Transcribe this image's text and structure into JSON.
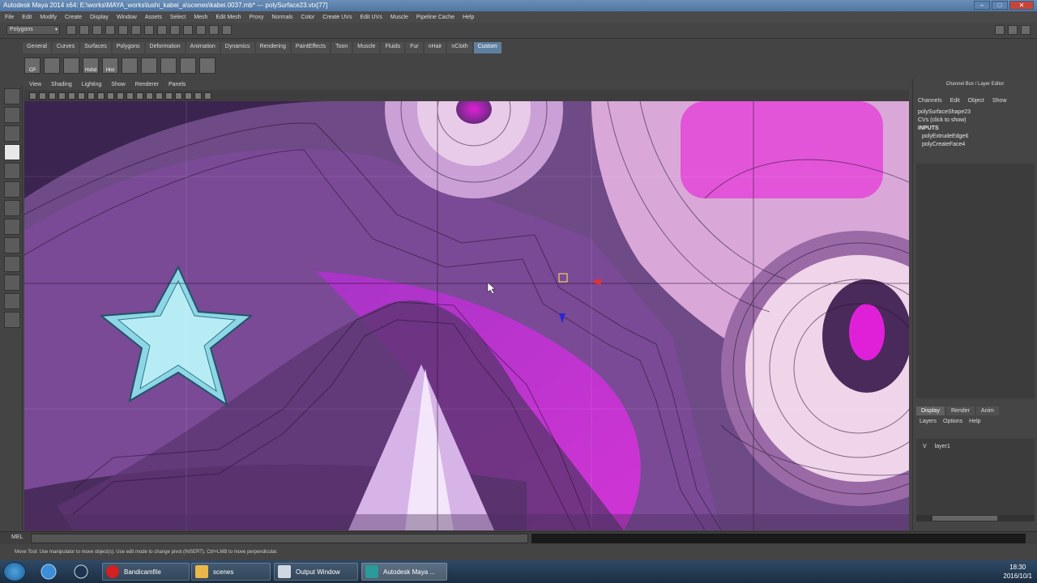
{
  "window": {
    "title": "Autodesk Maya 2014 x64: E:\\works\\MAYA_works\\lushi_kabei_a\\scenes\\kabei.0037.mb* --- polySurface23.vtx[77]",
    "min": "–",
    "max": "□",
    "close": "✕"
  },
  "menubar": [
    "File",
    "Edit",
    "Modify",
    "Create",
    "Display",
    "Window",
    "Assets",
    "Select",
    "Mesh",
    "Edit Mesh",
    "Proxy",
    "Normals",
    "Color",
    "Create UVs",
    "Edit UVs",
    "Muscle",
    "Pipeline Cache",
    "Help"
  ],
  "status_line": {
    "mode": "Polygons",
    "arrow": "▾"
  },
  "shelf": {
    "tabs": [
      "General",
      "Curves",
      "Surfaces",
      "Polygons",
      "Deformation",
      "Animation",
      "Dynamics",
      "Rendering",
      "PaintEffects",
      "Toon",
      "Muscle",
      "Fluids",
      "Fur",
      "nHair",
      "nCloth",
      "Custom"
    ],
    "active_tab": "Custom",
    "icons": [
      {
        "name": "cp-icon",
        "label": "CP"
      },
      {
        "name": "poly-icon",
        "label": ""
      },
      {
        "name": "checker-icon",
        "label": ""
      },
      {
        "name": "hshd-icon",
        "label": "Hshd"
      },
      {
        "name": "hist-icon",
        "label": "Hist"
      },
      {
        "name": "cube-icon",
        "label": ""
      },
      {
        "name": "sphere-icon",
        "label": ""
      },
      {
        "name": "cylinder-icon",
        "label": ""
      },
      {
        "name": "cone-icon",
        "label": ""
      },
      {
        "name": "torus-icon",
        "label": ""
      }
    ]
  },
  "panel_menu": [
    "View",
    "Shading",
    "Lighting",
    "Show",
    "Renderer",
    "Panels"
  ],
  "channel_box": {
    "title": "Channel Box / Layer Editor",
    "menu": [
      "Channels",
      "Edit",
      "Object",
      "Show"
    ],
    "shape": "polySurfaceShape23",
    "cvs": "CVs (click to show)",
    "inputs_header": "INPUTS",
    "inputs": [
      "polyExtrudeEdge6",
      "polyCreateFace4"
    ]
  },
  "layer_editor": {
    "tabs": [
      "Display",
      "Render",
      "Anim"
    ],
    "active_tab": "Display",
    "menu": [
      "Layers",
      "Options",
      "Help"
    ],
    "layers": [
      {
        "visible": "V",
        "name": "layer1"
      }
    ]
  },
  "command_line": {
    "label": "MEL"
  },
  "help_line": "Move Tool: Use manipulator to move object(s). Use edit mode to change pivot (INSERT). Ctrl+LMB to move perpendicular.",
  "taskbar": {
    "buttons": [
      {
        "label": "Bandicamfile",
        "color": "#d42020"
      },
      {
        "label": "scenes",
        "color": "#e8b84a"
      },
      {
        "label": "Output Window",
        "color": "#cfd8e2"
      },
      {
        "label": "Autodesk Maya ...",
        "color": "#2a9a9a"
      }
    ],
    "time": "18:30",
    "date": "2016/10/1"
  }
}
